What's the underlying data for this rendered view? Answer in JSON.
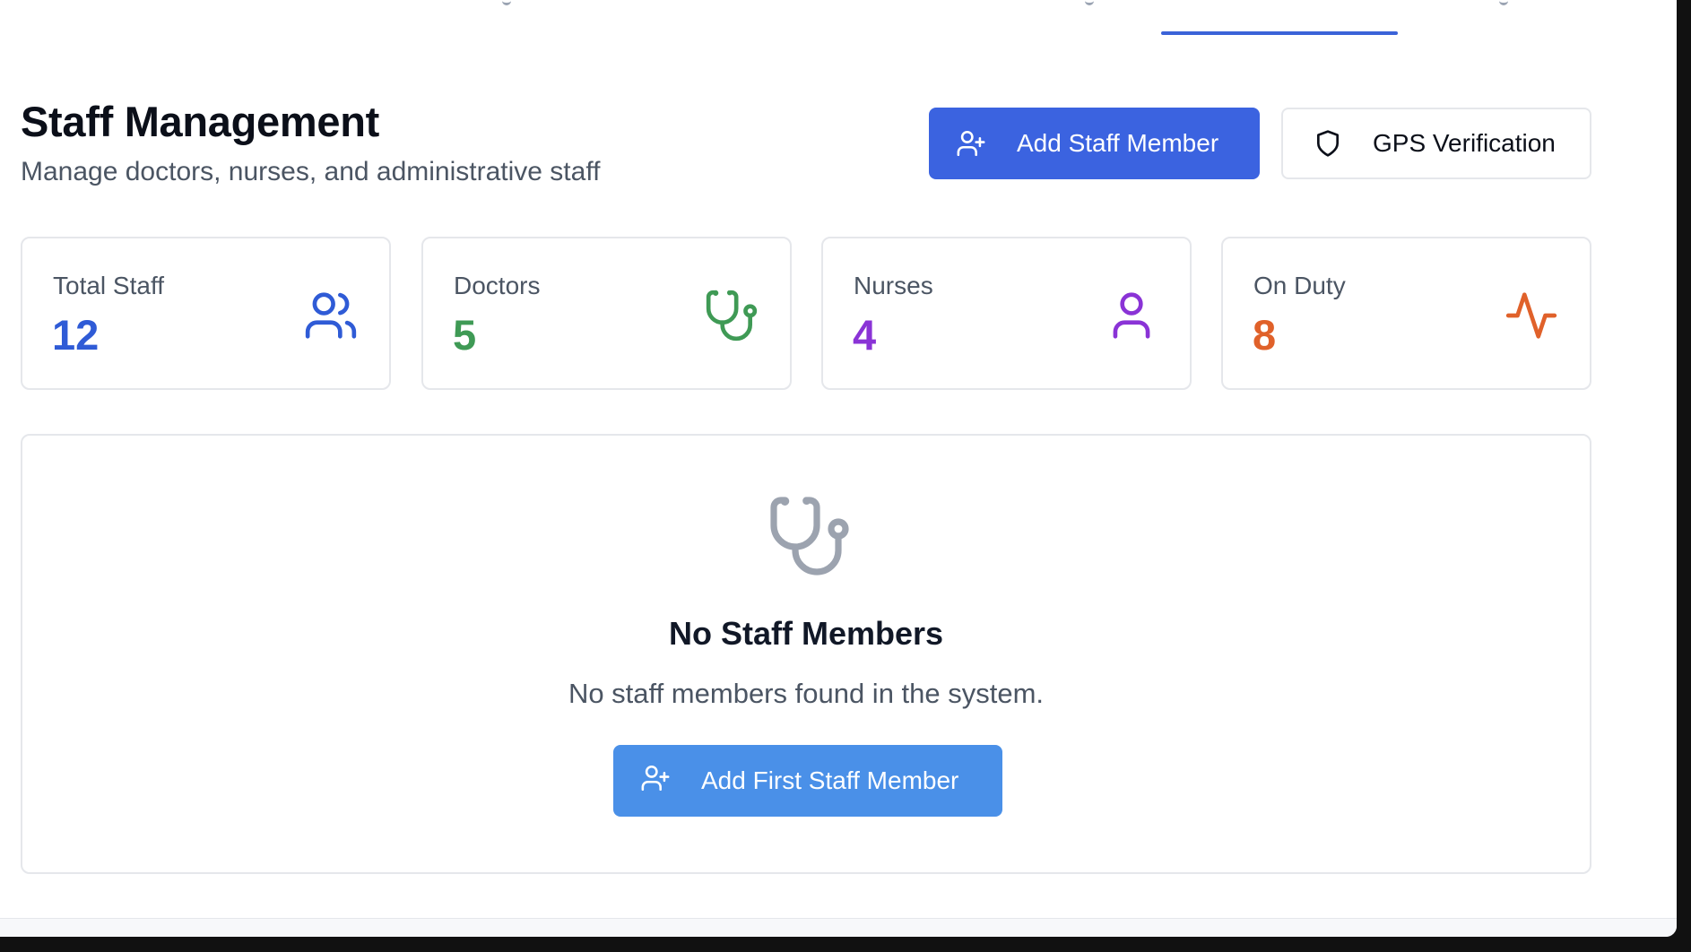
{
  "header": {
    "title": "Staff Management",
    "subtitle": "Manage doctors, nurses, and administrative staff"
  },
  "actions": {
    "add_staff_label": "Add Staff Member",
    "gps_label": "GPS Verification"
  },
  "stats": [
    {
      "label": "Total Staff",
      "value": "12",
      "color": "#2f5bd6",
      "icon": "users-icon"
    },
    {
      "label": "Doctors",
      "value": "5",
      "color": "#3f9a55",
      "icon": "stethoscope-icon"
    },
    {
      "label": "Nurses",
      "value": "4",
      "color": "#8a33d6",
      "icon": "user-icon"
    },
    {
      "label": "On Duty",
      "value": "8",
      "color": "#e0612a",
      "icon": "activity-icon"
    }
  ],
  "empty_state": {
    "icon": "stethoscope-icon",
    "title": "No Staff Members",
    "message": "No staff members found in the system.",
    "button_label": "Add First Staff Member"
  },
  "colors": {
    "primary": "#3b63e0",
    "secondary_button": "#4a90e8",
    "tab_indicator": "#3b63d8"
  }
}
